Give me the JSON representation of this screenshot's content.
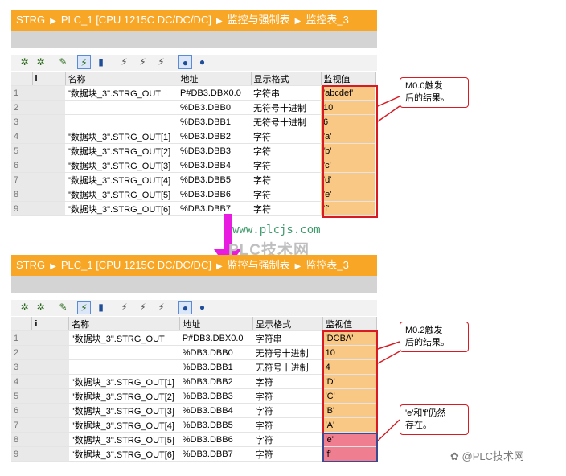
{
  "top": {
    "breadcrumb": [
      "STRG",
      "PLC_1 [CPU 1215C DC/DC/DC]",
      "监控与强制表",
      "监控表_3"
    ],
    "headers": {
      "index": "i",
      "name": "名称",
      "address": "地址",
      "format": "显示格式",
      "value": "监视值"
    },
    "rows": [
      {
        "n": "1",
        "name": "\"数据块_3\".STRG_OUT",
        "address": "P#DB3.DBX0.0",
        "format": "字符串",
        "value": "'abcdef'"
      },
      {
        "n": "2",
        "name": "",
        "address": "%DB3.DBB0",
        "format": "无符号十进制",
        "value": "10"
      },
      {
        "n": "3",
        "name": "",
        "address": "%DB3.DBB1",
        "format": "无符号十进制",
        "value": "6"
      },
      {
        "n": "4",
        "name": "\"数据块_3\".STRG_OUT[1]",
        "address": "%DB3.DBB2",
        "format": "字符",
        "value": "'a'"
      },
      {
        "n": "5",
        "name": "\"数据块_3\".STRG_OUT[2]",
        "address": "%DB3.DBB3",
        "format": "字符",
        "value": "'b'"
      },
      {
        "n": "6",
        "name": "\"数据块_3\".STRG_OUT[3]",
        "address": "%DB3.DBB4",
        "format": "字符",
        "value": "'c'"
      },
      {
        "n": "7",
        "name": "\"数据块_3\".STRG_OUT[4]",
        "address": "%DB3.DBB5",
        "format": "字符",
        "value": "'d'"
      },
      {
        "n": "8",
        "name": "\"数据块_3\".STRG_OUT[5]",
        "address": "%DB3.DBB6",
        "format": "字符",
        "value": "'e'"
      },
      {
        "n": "9",
        "name": "\"数据块_3\".STRG_OUT[6]",
        "address": "%DB3.DBB7",
        "format": "字符",
        "value": "'f'"
      }
    ],
    "callout": [
      "M0.0触发",
      "后的结果。"
    ]
  },
  "bottom": {
    "breadcrumb": [
      "STRG",
      "PLC_1 [CPU 1215C DC/DC/DC]",
      "监控与强制表",
      "监控表_3"
    ],
    "headers": {
      "index": "i",
      "name": "名称",
      "address": "地址",
      "format": "显示格式",
      "value": "监视值"
    },
    "rows": [
      {
        "n": "1",
        "name": "\"数据块_3\".STRG_OUT",
        "address": "P#DB3.DBX0.0",
        "format": "字符串",
        "value": "'DCBA'"
      },
      {
        "n": "2",
        "name": "",
        "address": "%DB3.DBB0",
        "format": "无符号十进制",
        "value": "10"
      },
      {
        "n": "3",
        "name": "",
        "address": "%DB3.DBB1",
        "format": "无符号十进制",
        "value": "4"
      },
      {
        "n": "4",
        "name": "\"数据块_3\".STRG_OUT[1]",
        "address": "%DB3.DBB2",
        "format": "字符",
        "value": "'D'"
      },
      {
        "n": "5",
        "name": "\"数据块_3\".STRG_OUT[2]",
        "address": "%DB3.DBB3",
        "format": "字符",
        "value": "'C'"
      },
      {
        "n": "6",
        "name": "\"数据块_3\".STRG_OUT[3]",
        "address": "%DB3.DBB4",
        "format": "字符",
        "value": "'B'"
      },
      {
        "n": "7",
        "name": "\"数据块_3\".STRG_OUT[4]",
        "address": "%DB3.DBB5",
        "format": "字符",
        "value": "'A'"
      },
      {
        "n": "8",
        "name": "\"数据块_3\".STRG_OUT[5]",
        "address": "%DB3.DBB6",
        "format": "字符",
        "value": "'e'"
      },
      {
        "n": "9",
        "name": "\"数据块_3\".STRG_OUT[6]",
        "address": "%DB3.DBB7",
        "format": "字符",
        "value": "'f'"
      }
    ],
    "callout1": [
      "M0.2触发",
      "后的结果。"
    ],
    "callout2": [
      "'e'和'f'仍然",
      "存在。"
    ]
  },
  "toolbar_icons": [
    "add-row-icon",
    "insert-row-icon",
    "edit-icon",
    "monitor-toggle-icon",
    "bar-chart-icon",
    "force-icon",
    "force-all-icon",
    "force-stop-icon",
    "glasses-monitor-icon",
    "monitor-once-icon"
  ],
  "watermark": {
    "url": "www.plcjs.com",
    "text": "PLC技术网"
  },
  "footer": "@PLC技术网",
  "colors": {
    "title_orange": "#f7a626",
    "value_fill": "#fac885",
    "highlight_pink": "#ef7f90",
    "red_box": "#d81b23",
    "arrow_magenta": "#e81ce0",
    "blue_box": "#3b4a8f"
  }
}
